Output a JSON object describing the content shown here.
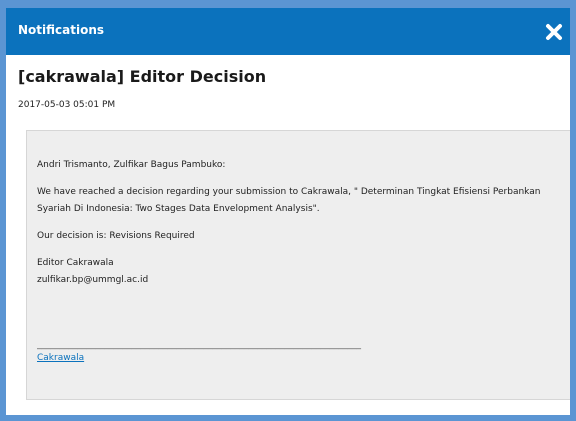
{
  "header": {
    "title": "Notifications",
    "close_icon": "close-icon"
  },
  "notification": {
    "subject": "[cakrawala] Editor Decision",
    "date": "2017-05-03 05:01 PM",
    "message": {
      "greeting": "Andri Trismanto, Zulfikar Bagus Pambuko:",
      "body": "We have reached a decision regarding your submission to Cakrawala, \" Determinan Tingkat Efisiensi Perbankan Syariah Di Indonesia: Two Stages Data Envelopment Analysis\".",
      "decision": "Our decision is: Revisions Required",
      "signature_name": "Editor Cakrawala",
      "signature_email": "zulfikar.bp@ummgl.ac.id",
      "divider": "________________________________________________________________________",
      "footer_link": "Cakrawala"
    }
  },
  "colors": {
    "header_bg": "#0b72bd",
    "page_bg": "#5b95d3",
    "message_bg": "#eeeeee"
  }
}
